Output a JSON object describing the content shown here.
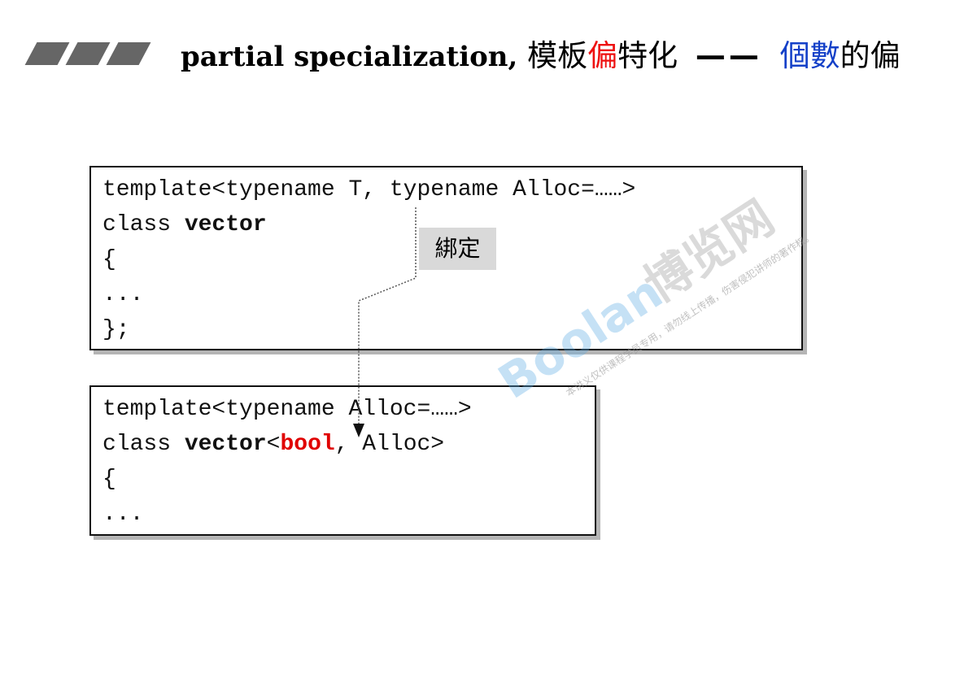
{
  "title": {
    "en": "partial specialization,",
    "cjk_1": "模板",
    "cjk_red": "偏",
    "cjk_2": "特化",
    "dash": "——",
    "cjk_blue": "個數",
    "cjk_3": "的偏"
  },
  "primary_template": {
    "line1": "template<typename T, typename Alloc=……>",
    "line2_kw": "class ",
    "line2_name": "vector",
    "line3": "{",
    "line4": "...",
    "line5": "};"
  },
  "specialization": {
    "line1": "template<typename Alloc=……>",
    "line2_kw": "class ",
    "line2_name": "vector",
    "line2_open": "<",
    "line2_arg": "bool",
    "line2_rest": ", Alloc>",
    "line3": "{",
    "line4": "..."
  },
  "bind_label": "綁定",
  "watermark": {
    "logo": "Boolan",
    "cn": "博览网",
    "note": "本讲义仅供课程学员专用，请勿线上传播，伤害侵犯讲师的著作权。"
  },
  "colors": {
    "accent_red": "#ee1111",
    "accent_blue": "#1440c8",
    "header_icon": "#666666",
    "label_bg": "#d9d9d9"
  }
}
